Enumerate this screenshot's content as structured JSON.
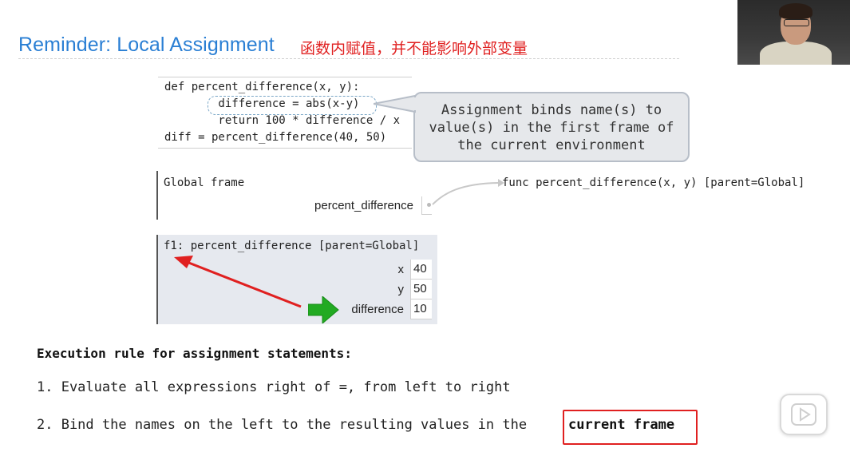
{
  "slide": {
    "title": "Reminder: Local Assignment",
    "annotation_cn": "函数内赋值，并不能影响外部变量"
  },
  "code": {
    "lines": [
      "def percent_difference(x, y):",
      "        difference = abs(x-y)",
      "        return 100 * difference / x",
      "diff = percent_difference(40, 50)"
    ]
  },
  "callout": {
    "text": "Assignment binds name(s) to\nvalue(s) in the first frame of\nthe current environment"
  },
  "global_frame": {
    "title": "Global frame",
    "binding_name": "percent_difference",
    "func_label": "func percent_difference(x, y) [parent=Global]"
  },
  "f1_frame": {
    "title": "f1: percent_difference [parent=Global]",
    "bindings": [
      {
        "name": "x",
        "value": "40"
      },
      {
        "name": "y",
        "value": "50"
      },
      {
        "name": "difference",
        "value": "10"
      }
    ]
  },
  "rules": {
    "heading": "Execution rule for assignment statements:",
    "step1": "1. Evaluate all expressions right of =, from left to right",
    "step2_prefix": "2. Bind the names on the left to the resulting values in the",
    "step2_emphasis": "current frame"
  },
  "colors": {
    "title_blue": "#2a7fd4",
    "annotation_red": "#e02020",
    "frame_bg": "#e6e9ef",
    "green_arrow": "#22aa22"
  },
  "icons": {
    "play": "play-icon",
    "pointer_arrow": "green-arrow-icon"
  }
}
